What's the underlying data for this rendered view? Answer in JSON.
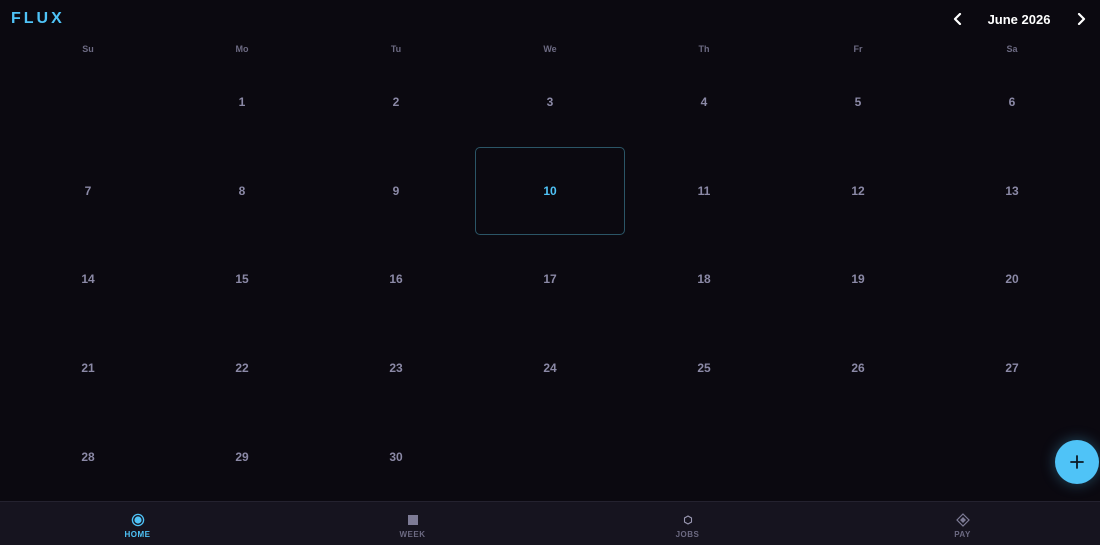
{
  "header": {
    "logo": "FLUX",
    "month_label": "June 2026",
    "prev_icon": "chevron-left-icon",
    "next_icon": "chevron-right-icon"
  },
  "weekdays": [
    "Su",
    "Mo",
    "Tu",
    "We",
    "Th",
    "Fr",
    "Sa"
  ],
  "calendar": {
    "today": "10",
    "weeks": [
      [
        "",
        "1",
        "2",
        "3",
        "4",
        "5",
        "6"
      ],
      [
        "7",
        "8",
        "9",
        "10",
        "11",
        "12",
        "13"
      ],
      [
        "14",
        "15",
        "16",
        "17",
        "18",
        "19",
        "20"
      ],
      [
        "21",
        "22",
        "23",
        "24",
        "25",
        "26",
        "27"
      ],
      [
        "28",
        "29",
        "30",
        "",
        "",
        "",
        ""
      ]
    ]
  },
  "fab": {
    "icon": "plus-icon"
  },
  "bottom_nav": {
    "items": [
      {
        "label": "HOME",
        "icon": "target-icon",
        "active": true
      },
      {
        "label": "WEEK",
        "icon": "square-icon",
        "active": false
      },
      {
        "label": "JOBS",
        "icon": "hexagon-icon",
        "active": false
      },
      {
        "label": "PAY",
        "icon": "diamond-icon",
        "active": false
      }
    ]
  },
  "colors": {
    "accent": "#4fc3f7",
    "background": "#0b0910",
    "day_text": "#8b89a6",
    "nav_background": "#16141f"
  }
}
